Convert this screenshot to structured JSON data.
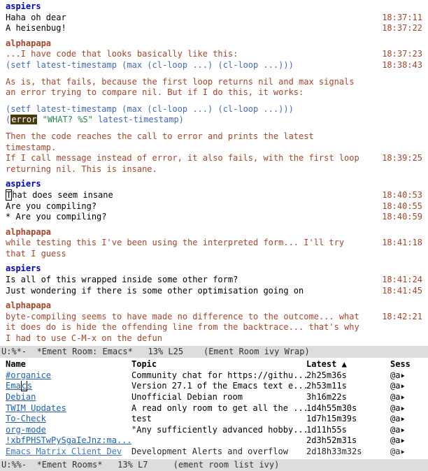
{
  "chat": {
    "m0": {
      "nick": "aspiers",
      "l0": "Haha oh dear",
      "t0": "18:37:11",
      "l1": "A heisenbug!",
      "t1": "18:37:22"
    },
    "m1": {
      "nick": "alphapapa",
      "l0": "...I have code that looks basically like this:",
      "t0": "18:37:23",
      "c0a": "(",
      "c0b": "setf",
      "c0c": " latest-timestamp (max (",
      "c0d": "cl-loop",
      "c0e": " ...) (",
      "c0f": "cl-loop",
      "c0g": " ...)))",
      "t1": "18:38:43",
      "l2": "As is, that fails, because the first loop returns nil and max signals an error trying to compare nil. But if I do this, it works:",
      "c1a": "(",
      "c1b": "setf",
      "c1c": " latest-timestamp (max (",
      "c1d": "cl-loop",
      "c1e": " ...) (",
      "c1f": "cl-loop",
      "c1g": " ...)))",
      "c2a": "(",
      "c2b": "error",
      "c2c": " ",
      "c2d": "\"WHAT? %S\"",
      "c2e": " latest-timestamp)",
      "l3": "Then the code reaches the call to error and prints the latest timestamp.",
      "l4": "If I call message instead of error, it also fails, with the first loop returning nil. This is insane.",
      "t4": "18:39:25"
    },
    "m2": {
      "nick": "aspiers",
      "l0a": "T",
      "l0b": "hat does seem insane",
      "t0": "18:40:53",
      "l1": "Are you compiling?",
      "t1": "18:40:55",
      "l2": " * Are you compiling?",
      "t2": "18:40:59"
    },
    "m3": {
      "nick": "alphapapa",
      "l0": "while testing this I've been using the interpreted form... I'll try that I guess",
      "t0": "18:41:18"
    },
    "m4": {
      "nick": "aspiers",
      "l0": "Is all of this wrapped inside some other form?",
      "t0": "18:41:24",
      "l1": "Just wondering if there is some other optimisation going on",
      "t1": "18:41:45"
    },
    "m5": {
      "nick": "alphapapa",
      "l0": "byte-compiling seems to have made no difference to the outcome... what it does do is hide the offending line from the backtrace... that's why I had to use C-M-x on the defun",
      "t0": "18:42:21"
    }
  },
  "modeline1": "U:%*-  *Ement Room: Emacs*   13% L25    (Ement Room ivy Wrap)",
  "modeline2": "U:%%-  *Ement Rooms*   13% L7     (ement room list ivy)",
  "roomsHeader": {
    "name": "Name",
    "topic": "Topic",
    "latest": "Latest",
    "arrow": "▲",
    "sess": "Sess"
  },
  "rooms": [
    {
      "name": "#organice",
      "topic": "Community chat for https://githu...",
      "latest": "2h25m36s",
      "sess": "@a"
    },
    {
      "nameA": "Ema",
      "nameB": "c",
      "nameC": "s",
      "topic": "Version 27.1 of the Emacs text e...",
      "latest": "2h53m11s",
      "sess": "@a"
    },
    {
      "name": "Debian",
      "topic": "Unofficial Debian room",
      "latest": "3h16m22s",
      "sess": "@a"
    },
    {
      "name": "TWIM Updates",
      "topic": "A read only room to get all the ...",
      "latest": "1d4h55m30s",
      "sess": "@a"
    },
    {
      "name": "To-Check",
      "topic": "test",
      "latest": "1d7h15m39s",
      "sess": "@a"
    },
    {
      "name": "org-mode",
      "topic": "\"Any sufficiently advanced hobby...",
      "latest": "1d11h55s",
      "sess": "@a"
    },
    {
      "name": "!xbfPHSTwPySgaIeJnz:ma...",
      "topic": "",
      "latest": "2d3h52m31s",
      "sess": "@a"
    },
    {
      "name": "Emacs Matrix Client Dev",
      "topic": "Development Alerts and overflow",
      "latest": "2d18h33m32s",
      "sess": "@a"
    }
  ],
  "arrowGlyph": "▸"
}
